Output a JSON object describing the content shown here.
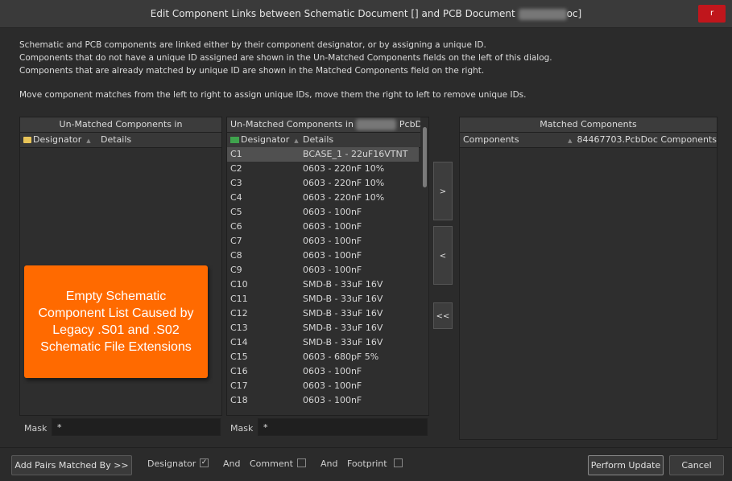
{
  "window": {
    "title_prefix": "Edit Component Links between Schematic Document [] and PCB Document",
    "title_suffix": "oc]",
    "close_label": "r"
  },
  "description": {
    "line1": "Schematic and PCB components are linked either by their component designator, or by assigning a unique ID.",
    "line2": "Components that do not have a unique ID assigned are shown in the Un-Matched Components fields on the left of this dialog.",
    "line3": "Components that are already matched by unique ID are shown in the Matched Components field on the right.",
    "line4": "Move component matches from the left to right to assign unique IDs, move them the right to left to remove unique IDs."
  },
  "left_panel": {
    "title": "Un-Matched Components in",
    "col_designator": "Designator",
    "col_details": "Details",
    "mask_label": "Mask",
    "mask_value": "*"
  },
  "middle_panel": {
    "title_prefix": "Un-Matched Components in",
    "title_suffix": "PcbD...",
    "col_designator": "Designator",
    "col_details": "Details",
    "mask_label": "Mask",
    "mask_value": "*",
    "rows": [
      {
        "designator": "C1",
        "details": "BCASE_1 - 22uF16VTNT"
      },
      {
        "designator": "C2",
        "details": "0603 - 220nF 10%"
      },
      {
        "designator": "C3",
        "details": "0603 - 220nF 10%"
      },
      {
        "designator": "C4",
        "details": "0603 - 220nF 10%"
      },
      {
        "designator": "C5",
        "details": "0603 - 100nF"
      },
      {
        "designator": "C6",
        "details": "0603 - 100nF"
      },
      {
        "designator": "C7",
        "details": "0603 - 100nF"
      },
      {
        "designator": "C8",
        "details": "0603 - 100nF"
      },
      {
        "designator": "C9",
        "details": "0603 - 100nF"
      },
      {
        "designator": "C10",
        "details": "SMD-B - 33uF 16V"
      },
      {
        "designator": "C11",
        "details": "SMD-B - 33uF 16V"
      },
      {
        "designator": "C12",
        "details": "SMD-B - 33uF 16V"
      },
      {
        "designator": "C13",
        "details": "SMD-B - 33uF 16V"
      },
      {
        "designator": "C14",
        "details": "SMD-B - 33uF 16V"
      },
      {
        "designator": "C15",
        "details": "0603 - 680pF 5%"
      },
      {
        "designator": "C16",
        "details": "0603 - 100nF"
      },
      {
        "designator": "C17",
        "details": "0603 - 100nF"
      },
      {
        "designator": "C18",
        "details": "0603 - 100nF"
      }
    ]
  },
  "arrows": {
    "right": ">",
    "left": "<",
    "all_left": "<<"
  },
  "right_panel": {
    "title": "Matched Components",
    "col_components": "Components",
    "col_pcb": "84467703.PcbDoc Components"
  },
  "callout": {
    "text": "Empty Schematic Component List Caused by Legacy .S01 and .S02 Schematic File Extensions"
  },
  "bottom": {
    "add_pairs_label": "Add Pairs Matched By >>",
    "designator_label": "Designator",
    "designator_checked": true,
    "and1": "And",
    "comment_label": "Comment",
    "comment_checked": false,
    "and2": "And",
    "footprint_label": "Footprint",
    "footprint_checked": false,
    "perform_label": "Perform Update",
    "cancel_label": "Cancel",
    "check_glyph": "✓"
  }
}
